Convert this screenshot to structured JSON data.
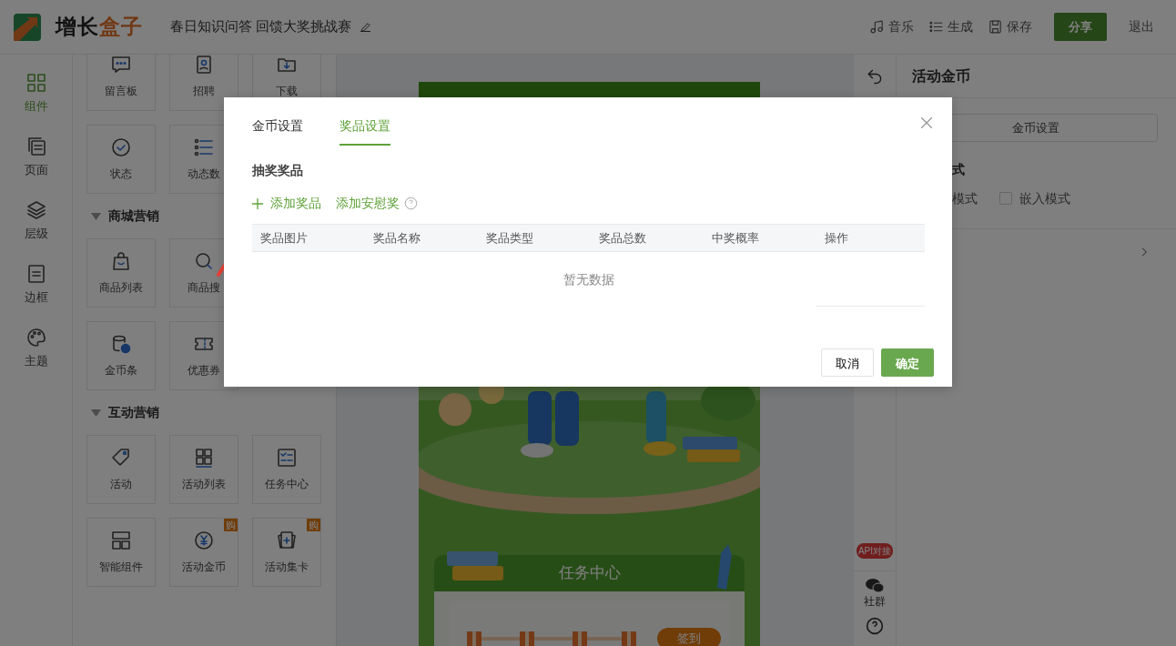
{
  "header": {
    "logo": {
      "parts": [
        "增长",
        "盒子"
      ]
    },
    "title": "春日知识问答 回馈大奖挑战赛",
    "actions": [
      {
        "kind": "music",
        "label": "音乐"
      },
      {
        "kind": "list",
        "label": "生成"
      },
      {
        "kind": "save",
        "label": "保存"
      }
    ],
    "share_button": "分享",
    "exit_link": "退出"
  },
  "rail": [
    {
      "kind": "grid",
      "label": "组件",
      "selected": true
    },
    {
      "kind": "pages",
      "label": "页面",
      "selected": false
    },
    {
      "kind": "layers",
      "label": "层级",
      "selected": false
    },
    {
      "kind": "border",
      "label": "边框",
      "selected": false
    },
    {
      "kind": "palette",
      "label": "主题",
      "selected": false
    }
  ],
  "components": [
    {
      "rows": [
        [
          {
            "kind": "message",
            "label": "留言板"
          },
          {
            "kind": "resume",
            "label": "招聘"
          },
          {
            "kind": "download",
            "label": "下载"
          }
        ],
        [
          {
            "kind": "status",
            "label": "状态"
          },
          {
            "kind": "datalist",
            "label": "动态数"
          }
        ]
      ]
    },
    {
      "title": "商城营销",
      "rows": [
        [
          {
            "kind": "bag",
            "label": "商品列表"
          },
          {
            "kind": "search",
            "label": "商品搜"
          }
        ],
        [
          {
            "kind": "coins",
            "label": "金币条"
          },
          {
            "kind": "ticket",
            "label": "优惠券"
          }
        ]
      ]
    },
    {
      "title": "互动营销",
      "rows": [
        [
          {
            "kind": "tag",
            "label": "活动"
          },
          {
            "kind": "grid4",
            "label": "活动列表"
          },
          {
            "kind": "tasks",
            "label": "任务中心"
          }
        ],
        [
          {
            "kind": "layout",
            "label": "智能组件"
          },
          {
            "kind": "yen",
            "label": "活动金币",
            "badge": "购"
          },
          {
            "kind": "cards",
            "label": "活动集卡",
            "badge": "购"
          }
        ]
      ]
    }
  ],
  "preview": {
    "section_title": "任务中心",
    "checkin_button": "签到"
  },
  "tools": {
    "api_badge": "API对接",
    "community": "社群"
  },
  "right_panel": {
    "title": "活动金币",
    "settings_button": "金币设置",
    "mode_heading": "式",
    "modes": [
      {
        "label": "模式"
      },
      {
        "label": "嵌入模式",
        "checked": false
      }
    ]
  },
  "modal": {
    "tabs": [
      {
        "label": "金币设置",
        "selected": false
      },
      {
        "label": "奖品设置",
        "selected": true
      }
    ],
    "section_title": "抽奖奖品",
    "add_prize": "添加奖品",
    "add_consolation": "添加安慰奖",
    "columns": [
      "奖品图片",
      "奖品名称",
      "奖品类型",
      "奖品总数",
      "中奖概率",
      "操作"
    ],
    "empty_text": "暂无数据",
    "cancel_button": "取消",
    "ok_button": "确定"
  }
}
